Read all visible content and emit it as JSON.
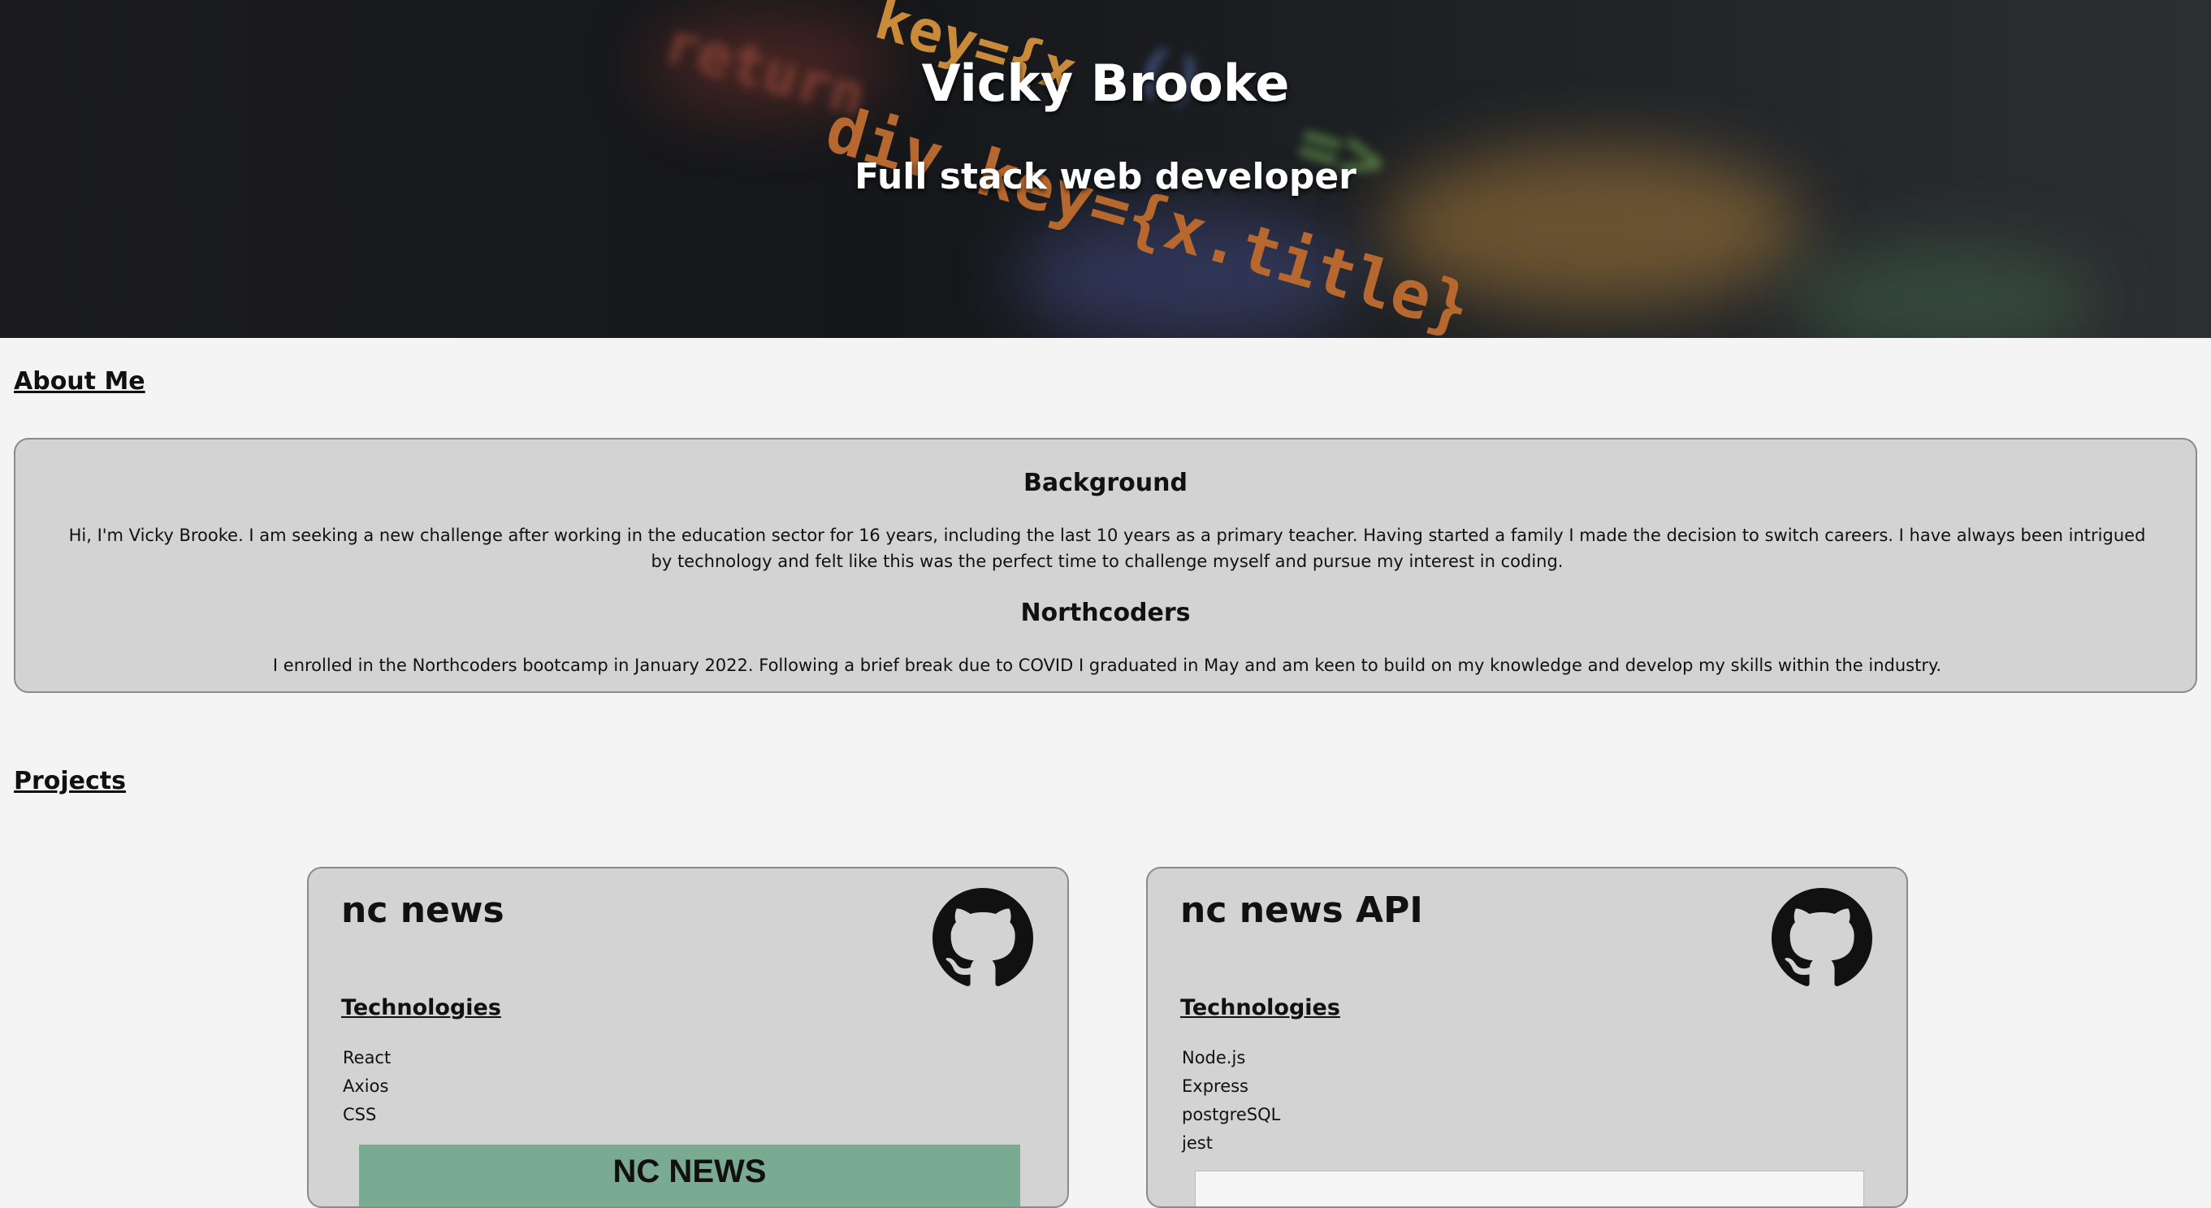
{
  "hero": {
    "title": "Vicky Brooke",
    "subtitle": "Full stack web developer",
    "background_code": {
      "fragments": [
        "key={x",
        "div key={x.title}",
        "return",
        "<div",
        "()",
        "=>"
      ],
      "colors": [
        "#d88a2c",
        "#9b4a3b",
        "#5a6fb0",
        "#6aa04f",
        "#c98a3a"
      ]
    }
  },
  "about": {
    "heading": "About Me",
    "background_title": "Background",
    "background_text": "Hi, I'm Vicky Brooke. I am seeking a new challenge after working in the education sector for 16 years, including the last 10 years as a primary teacher. Having started a family I made the decision to switch careers. I have always been intrigued by technology and felt like this was the perfect time to challenge myself and pursue my interest in coding.",
    "northcoders_title": "Northcoders",
    "northcoders_text": "I enrolled in the Northcoders bootcamp in January 2022. Following a brief break due to COVID I graduated in May and am keen to build on my knowledge and develop my skills within the industry."
  },
  "projects": {
    "heading": "Projects",
    "items": [
      {
        "title": "nc news",
        "tech_heading": "Technologies",
        "technologies": [
          "React",
          "Axios",
          "CSS"
        ],
        "github_icon": "github-icon",
        "preview_text": "NC NEWS"
      },
      {
        "title": "nc news API",
        "tech_heading": "Technologies",
        "technologies": [
          "Node.js",
          "Express",
          "postgreSQL",
          "jest"
        ],
        "github_icon": "github-icon"
      }
    ]
  },
  "colors": {
    "page_background": "#f4f4f4",
    "card_background": "#d3d3d3",
    "card_border": "#8a8a8a",
    "preview_green": "#7aaa92"
  }
}
